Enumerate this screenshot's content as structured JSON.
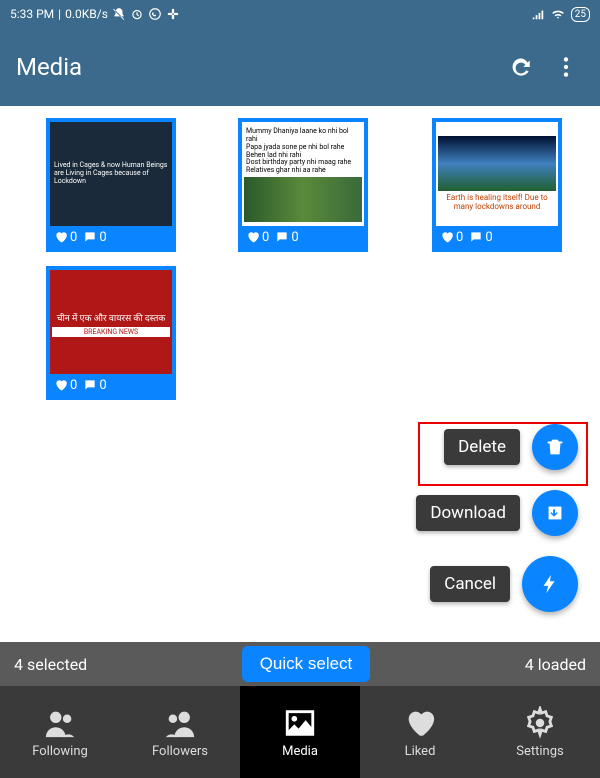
{
  "status": {
    "time": "5:33 PM",
    "net": "0.0KB/s",
    "battery": "25"
  },
  "header": {
    "title": "Media"
  },
  "cards": [
    {
      "caption": "Lived in Cages & now Human Beings are Living in Cages because of Lockdown",
      "likes": "0",
      "comments": "0"
    },
    {
      "caption": "Mummy Dhaniya laane ko nhi bol rahi\nPapa jyada sone pe nhi bol rahe\nBehen lad nhi rahi\nDost birthday party nhi maag rahe\nRelatives ghar nhi aa rahe",
      "likes": "0",
      "comments": "0"
    },
    {
      "caption": "Earth is healing itself! Due to many lockdowns around",
      "likes": "0",
      "comments": "0"
    },
    {
      "caption": "चीन में एक और वायरस की दस्तक",
      "likes": "0",
      "comments": "0"
    }
  ],
  "actions": {
    "delete": "Delete",
    "download": "Download",
    "cancel": "Cancel"
  },
  "footer": {
    "selected": "4 selected",
    "quick": "Quick select",
    "loaded": "4 loaded"
  },
  "nav": {
    "following": "Following",
    "followers": "Followers",
    "media": "Media",
    "liked": "Liked",
    "settings": "Settings"
  }
}
